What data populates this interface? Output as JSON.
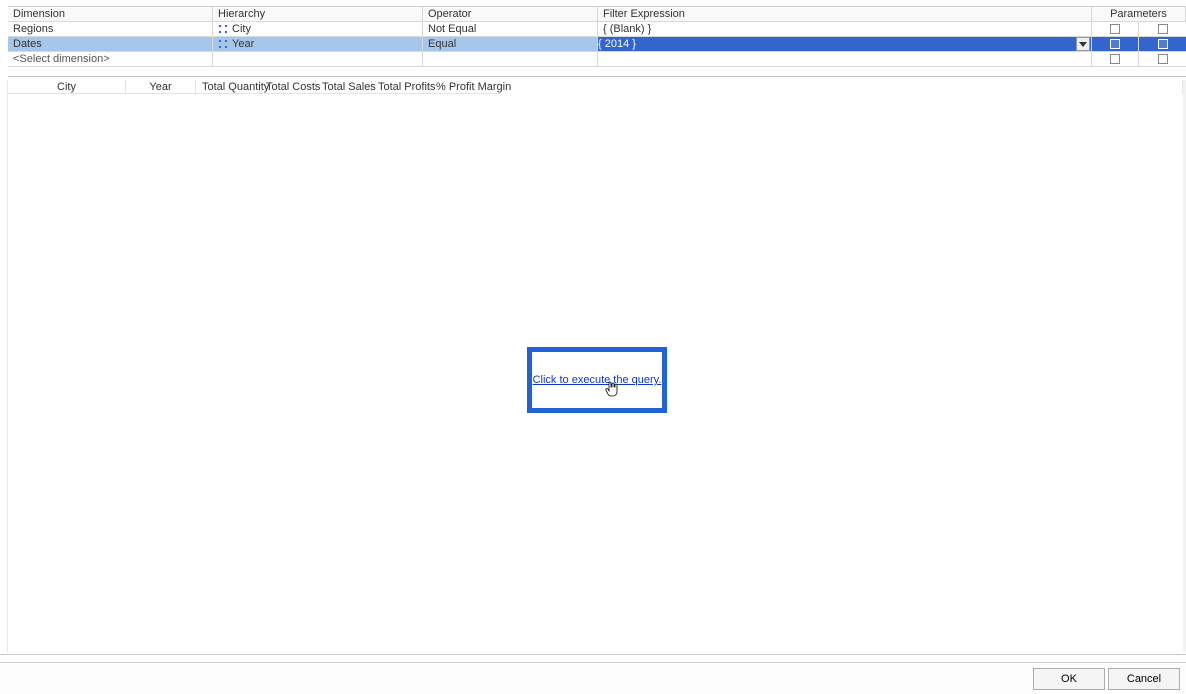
{
  "filterGrid": {
    "headers": {
      "dimension": "Dimension",
      "hierarchy": "Hierarchy",
      "operator": "Operator",
      "filterExpression": "Filter Expression",
      "parameters": "Parameters"
    },
    "rows": [
      {
        "dimension": "Regions",
        "hierarchy": "City",
        "operator": "Not Equal",
        "filterExpression": "{ (Blank) }",
        "selected": false
      },
      {
        "dimension": "Dates",
        "hierarchy": "Year",
        "operator": "Equal",
        "filterExpression": "{ 2014 }",
        "selected": true
      }
    ],
    "placeholder": "<Select dimension>"
  },
  "resultColumns": [
    "City",
    "Year",
    "Total Quantity",
    "Total Costs",
    "Total Sales",
    "Total Profits",
    "% Profit Margin"
  ],
  "preview": {
    "executeLink": "Click to execute the query."
  },
  "footer": {
    "ok": "OK",
    "cancel": "Cancel"
  }
}
